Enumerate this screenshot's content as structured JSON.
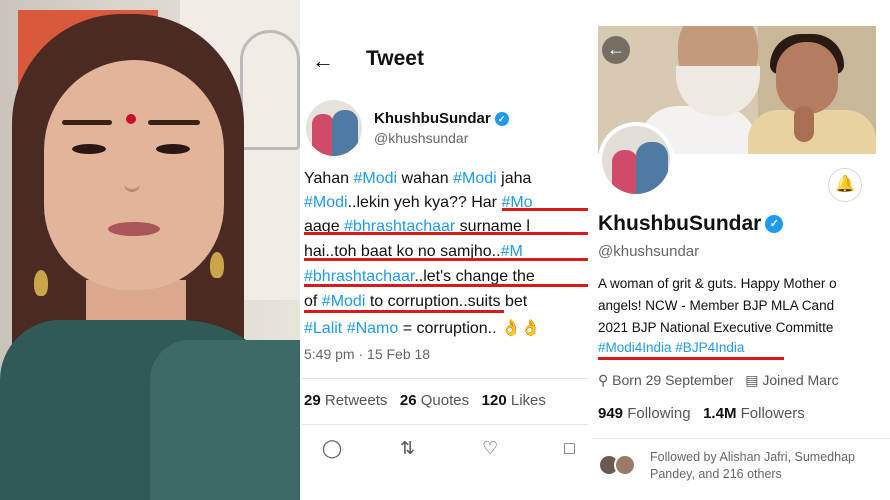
{
  "tweet": {
    "back_icon": "back-arrow-icon",
    "title": "Tweet",
    "author_name": "KhushbuSundar",
    "author_handle": "@khushsundar",
    "lines": [
      [
        {
          "t": "Yahan ",
          "tag": false
        },
        {
          "t": "#Modi",
          "tag": true
        },
        {
          "t": " wahan ",
          "tag": false
        },
        {
          "t": "#Modi",
          "tag": true
        },
        {
          "t": " jaha",
          "tag": false
        }
      ],
      [
        {
          "t": "#Modi",
          "tag": true
        },
        {
          "t": "..lekin yeh kya?? Har ",
          "tag": false
        },
        {
          "t": "#Mo",
          "tag": true
        }
      ],
      [
        {
          "t": "aage ",
          "tag": false
        },
        {
          "t": "#bhrashtachaar",
          "tag": true
        },
        {
          "t": " surname l",
          "tag": false
        }
      ],
      [
        {
          "t": "hai..toh baat ko no samjho..",
          "tag": false
        },
        {
          "t": "#M",
          "tag": true
        }
      ],
      [
        {
          "t": "#bhrashtachaar",
          "tag": true
        },
        {
          "t": "..let's change the",
          "tag": false
        }
      ],
      [
        {
          "t": "of ",
          "tag": false
        },
        {
          "t": "#Modi",
          "tag": true
        },
        {
          "t": " to corruption..suits bet",
          "tag": false
        }
      ],
      [
        {
          "t": "#Lalit",
          "tag": true
        },
        {
          "t": " ",
          "tag": false
        },
        {
          "t": "#Namo",
          "tag": true
        },
        {
          "t": " = corruption.. 👌👌",
          "tag": false
        }
      ]
    ],
    "time": "5:49 pm · 15 Feb 18",
    "retweets": "29",
    "retweets_label": "Retweets",
    "quotes": "26",
    "quotes_label": "Quotes",
    "likes": "120",
    "likes_label": "Likes"
  },
  "profile": {
    "name": "KhushbuSundar",
    "handle": "@khushsundar",
    "bio_lines": [
      "A woman of grit & guts. Happy Mother o",
      "angels!  NCW - Member   BJP MLA Cand",
      "2021  BJP National Executive Committe",
      "#Modi4India  #BJP4India"
    ],
    "born": "Born 29 September",
    "joined": "Joined Marc",
    "following_count": "949",
    "following_label": "Following",
    "followers_count": "1.4M",
    "followers_label": "Followers",
    "followed_by_line1": "Followed by Alishan Jafri, Sumedhap",
    "followed_by_line2": "Pandey, and 216 others"
  },
  "colors": {
    "accent": "#1d9bf0",
    "underline": "#d81a1a"
  }
}
